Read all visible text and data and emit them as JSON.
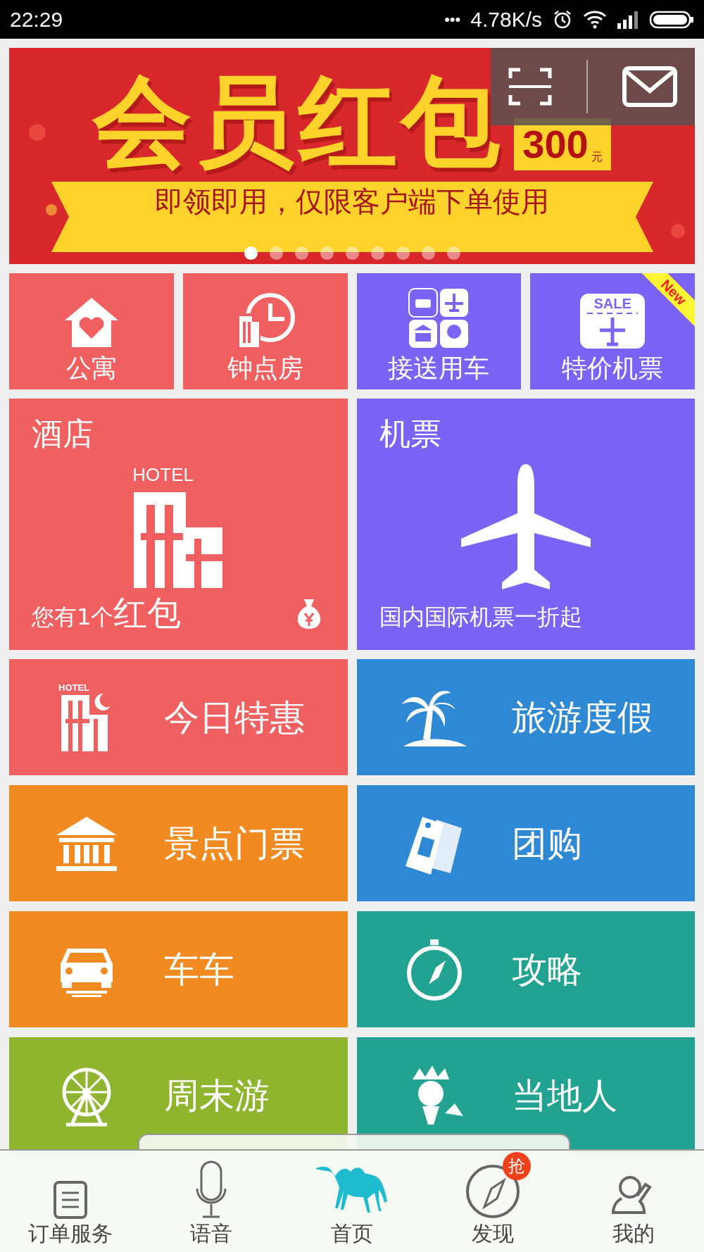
{
  "status_bar": {
    "time": "22:29",
    "dots": "•••",
    "speed": "4.78K/s"
  },
  "banner": {
    "title": "会员红包",
    "amount": "300",
    "unit": "元",
    "subtitle": "即领即用，仅限客户端下单使用",
    "dots": [
      {
        "selected": true
      },
      {
        "selected": false
      },
      {
        "selected": false
      },
      {
        "selected": false
      },
      {
        "selected": false
      },
      {
        "selected": false
      },
      {
        "selected": false
      },
      {
        "selected": false
      },
      {
        "selected": false
      }
    ]
  },
  "quick_tiles": [
    {
      "label": "公寓",
      "color": "#f06060",
      "kind": "apartment"
    },
    {
      "label": "钟点房",
      "color": "#f06060",
      "kind": "hourly"
    },
    {
      "label": "接送用车",
      "color": "#7b63f5",
      "kind": "transfer"
    },
    {
      "label": "特价机票",
      "color": "#7b63f5",
      "kind": "sale",
      "icon_text": "SALE",
      "badge": "New"
    }
  ],
  "feature_tiles": [
    {
      "title": "酒店",
      "color": "#f06060",
      "kind": "hotel",
      "icon_text": "HOTEL",
      "note": "您有1个",
      "highlight": "红包"
    },
    {
      "title": "机票",
      "color": "#7b63f5",
      "kind": "plane",
      "note": "国内国际机票一折起"
    }
  ],
  "list_tiles": [
    {
      "label": "今日特惠",
      "color": "#f06060",
      "kind": "hotel-moon",
      "icon_text": "HOTEL"
    },
    {
      "label": "旅游度假",
      "color": "#2f88d4",
      "kind": "palm"
    },
    {
      "label": "景点门票",
      "color": "#f28a22",
      "kind": "temple"
    },
    {
      "label": "团购",
      "color": "#2f88d4",
      "kind": "coupon"
    },
    {
      "label": "车车",
      "color": "#f28a22",
      "kind": "car"
    },
    {
      "label": "攻略",
      "color": "#22a392",
      "kind": "compass"
    },
    {
      "label": "周末游",
      "color": "#8fb52f",
      "kind": "ferris"
    },
    {
      "label": "当地人",
      "color": "#22a392",
      "kind": "person"
    }
  ],
  "nav": [
    {
      "label": "订单服务",
      "kind": "list",
      "selected": false
    },
    {
      "label": "语音",
      "kind": "mic",
      "selected": false
    },
    {
      "label": "首页",
      "kind": "camel",
      "selected": true
    },
    {
      "label": "发现",
      "kind": "compass",
      "selected": false,
      "badge": "抢"
    },
    {
      "label": "我的",
      "kind": "person",
      "selected": false
    }
  ]
}
